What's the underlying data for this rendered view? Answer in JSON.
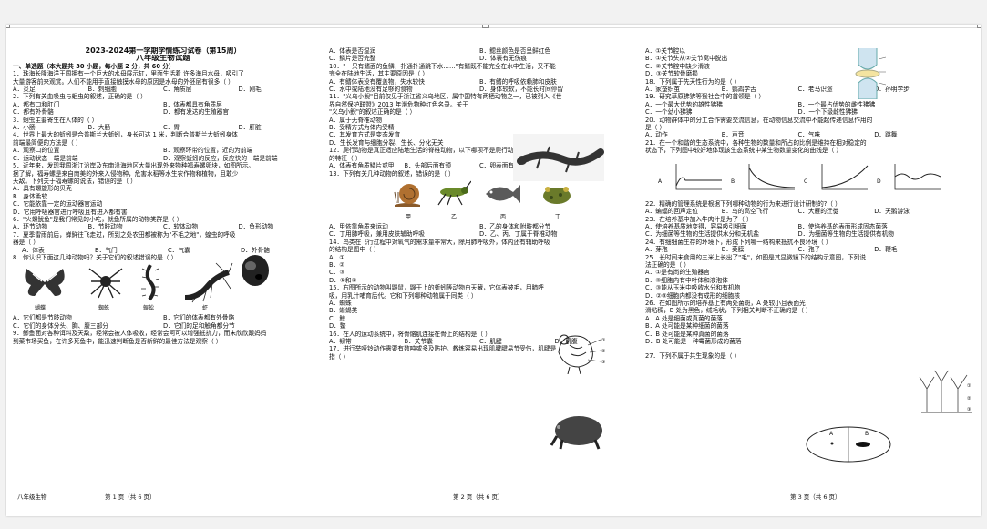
{
  "col1": {
    "title": "2023-2024第一学期学情练习试卷（第15周）",
    "subtitle": "八年级生物试题",
    "sec1": "一、单选题（本大题共 30 小题，每小题 2 分，共 60 分）",
    "l1": "1．珠海长隆海洋王国拥有一个巨大的水母展示缸，里面生活着  许多海月水母，吸引了",
    "l2": "大量游客前来观赏。人们不能用手直接触摸水母的原因是水母的外胚层有很多（     ）",
    "q1": [
      "A．炎足",
      "B．刺细胞",
      "C．角质层",
      "D．刚毛"
    ],
    "l3": "2．下列有关血吸虫与蛔虫的叙述，正确的是（     ）",
    "q2": [
      "A．都有口和肛门",
      "B．体表都具有角质层",
      "C．都有外骨骼",
      "D．都有发达的生殖器官"
    ],
    "l4": "3．蛔虫主要寄生在人体的（     ）",
    "q3": [
      "A．小肠",
      "B．大肠",
      "C．胃",
      "D．肝脏"
    ],
    "l5": "4．世界上最大的蚯蚓是合普斯兰大蚯蚓，身长可达 1 米，判断合普斯兰大蚯蚓身体",
    "l6": "前端最简便的方法是（     ）",
    "q4": [
      "A．观察口的位置",
      "B．观察环带的位置，近的为前端",
      "C．运动状态一端是前端",
      "D．观察蚯蚓的反应，反应快的一端是前端"
    ],
    "l7": "5．近年来，发现我国浙江沿岸及东南沿海地区大量出现外来物种福寿螺卵块，如图所示。",
    "l8": "据了解，福寿螺是来自南美的外来入侵物种，危害水稻等水生农作物和植物，且敢少",
    "l9": "天敌。下列关于福寿螺的说法，错误的是（     ）",
    "q5": [
      "A．具有螺旋形的贝壳",
      "B．身体柔软",
      "C．它能依靠一定的运动器官运动",
      "D．它用呼吸器官进行呼吸且有进入都有害"
    ],
    "l10": "6．\"火螺鱿鱼\"是我们常见的小吃，就鱼所属的动物类群是（     ）",
    "q6": [
      "A．环节动物",
      "B．节肢动物",
      "C．软体动物",
      "D．鱼形动物"
    ],
    "l11": "7．夏季雷雨前后，蝉鲜往飞走过，所到之处农田都被称为\"不毛之地\"，蝗虫的呼吸",
    "l12": "器是（     ）",
    "q7": [
      "A．体表",
      "B．气门",
      "C．气囊",
      "D．外骨骼"
    ],
    "l13": "8．你认识下面这几种动物吗？关于它们的叙述错误的是（     ）",
    "animals": [
      "蝴蝶",
      "蜘蛛",
      "蜈蚣",
      "虾"
    ],
    "q8": [
      "A．它们都是节肢动物",
      "B．它们的体表都有外骨骼",
      "C．它们的身体分头、胸、腹三部分",
      "D．它们的足和触角都分节"
    ],
    "l14": "9．鲫鱼面对各种饵料及天敌，经常会被人体吸收，经常会阿可以增强抵抗力，而末欣欣跟妈妈",
    "l15": "到菜市场买鱼，在许多死鱼中，能迅速判断鱼是否新鲜的最佳方法是观察（     ）"
  },
  "col2": {
    "q9": [
      "A．体表是否湿润",
      "B．鳃丝颜色是否呈鲜红色",
      "C．鳞片是否完整",
      "D．体表有无伤痕"
    ],
    "l1": "10．\"一只有鳍面的鱼鳞，扑通扑通跳下水……\"有鳍既不能完全在水中生活，又不能",
    "l2": "完全在陆地生活，其主要原因是（     ）",
    "q10": [
      "A．有鳍体表没有覆盖物，失水较快",
      "B．有鳍的呼吸依赖肺和皮肤",
      "C．水中或陆地没有足够的食物",
      "D．身体较软，不能长时间停留"
    ],
    "l3": "11．\"义乌小鲵\"目前仅见于浙江省义乌地区，属中国特有两栖动物之一，已被列入《世",
    "l4": "界自然保护联盟》2013 年濒危物种红色名录。关于",
    "l5": "\"义乌小鲵\"的叙述正确的是（     ）",
    "q11": [
      "A．属于无脊椎动物",
      "B．受精方式为体内受精",
      "C．其发育方式是变态发育",
      "D．生长发育与细胞分裂、生长、分化无关"
    ],
    "l6": "12．爬行动物是真正适应陆地生活的脊椎动物，以下哪项不是爬行动物适应陆地生活",
    "l7": "的特征（     ）",
    "q12": [
      "A．体表有角质鳞片或甲",
      "B．头部后面有颈",
      "C．卵表面有坚韧的卵壳",
      "D．用鳃呼吸"
    ],
    "l8": "13．下列有关几种动物的叙述，错误的是（     ）",
    "animals": [
      "甲",
      "乙",
      "丙",
      "丁"
    ],
    "q13": [
      "A．甲依靠角质来运动",
      "B．乙的身体和附肢都分节",
      "C．丁用肺呼吸，兼用皮肤辅助呼吸",
      "D．乙、丙、丁属于脊椎动物"
    ],
    "l9": "14．鸟类在飞行过程中对氧气的需求量非常大，除用肺呼吸外，体内还有辅助呼吸",
    "l10": "的结构是图中（     ）",
    "q14": [
      "A．①",
      "B．②",
      "C．③",
      "D．①和②"
    ],
    "l11": "15．右图所示的动物叫鼹鼠，鼹于上的蚯蚓等动物白天藏，它体表被毛，用肺呼",
    "l12": "吸，用乳汁哺育后代。它和下列哪种动物属于同类（     ）",
    "q15": [
      "A．蜘蛛",
      "B．蜥蜴类",
      "C．鲸",
      "D．鳖"
    ],
    "l13": "16．在人的运动系统中，将骨骼肌连接在骨上的结构是（     ）",
    "q16": [
      "A．韧带",
      "B．关节囊",
      "C．肌腱",
      "D．肌腹"
    ],
    "l14": "17．进行举哑铃动作需要有数吨或多及防护。教练容易出现肌腱腱易节受伤，肌腱是",
    "l15": "指（     ）"
  },
  "col3": {
    "q17": [
      "A．①关节腔以",
      "B．①关节头从②关节窝中脱出",
      "C．②关节腔中缺少滑液",
      "D．③关节软骨磨损"
    ],
    "l1": "18．下列属于先天性行为的是（     ）",
    "q18": [
      "A．家蚕织茧",
      "B．鹦鹉学舌",
      "C．老马识途",
      "D．孙明学步"
    ],
    "l2": "19．研究草原狒狒等猴社会中的首领是（     ）",
    "q19": [
      "A．一个最大优势的雄性狒狒",
      "B．一个最占优势的雌性狒狒",
      "C．一个幼小狒狒",
      "D．一个下级雌性狒狒"
    ],
    "l3": "20．动物群体中的分工合作需要交流信息，在动物信息交流中不能起传递信息作用的",
    "l4": "是（     ）",
    "q20": [
      "A．动作",
      "B．声音",
      "C．气味",
      "D．跳舞"
    ],
    "l5": "21．在一个和谐的生态系统中，各种生物的数量和所占的比例是维持在相对稳定的",
    "l6": "状态下，下列图中较好地体现该生态系统中某生物数量变化的曲线是（     ）",
    "graphs": [
      "A",
      "B",
      "C",
      "D"
    ],
    "l7": "22．精确的管理系统是根据下列哪种动物的行为来进行设计研制的?（     ）",
    "q22": [
      "A．蝙蝠的回声定位",
      "B．鸟的高空飞行",
      "C．大雁的迁徙",
      "D．天鹅游泳"
    ],
    "l8": "23．在培养基中加入牛肉汁是为了（     ）",
    "q23": [
      "A．使培养基质地变得，容易吸引细菌",
      "B．使培养基的表面形成固态菌落",
      "C．为细菌等生物的生活提供水分和无机盐",
      "D．为细菌等生物的生活提供有机物"
    ],
    "l9": "24．有细细菌生存的环境下，形成下列哪一结构来抵抗不良环境（     ）",
    "q24": [
      "A．芽孢",
      "B．荚膜",
      "C．孢子",
      "D．鞭毛"
    ],
    "l10": "25．长时间未食用的三米上长出了\"毛\"，如图是其显微镜下的结构示意图，下列说",
    "l11": "法正确的是（     ）",
    "q25": [
      "A．①是有尚的生殖器官",
      "B．③细胞内有中叶体和液泡体",
      "C．③能从玉米中吸收水分和有机物",
      "D．②③细胞内都没有成形的细胞核"
    ],
    "l12": "26．在如图所示的培养基上有两处菌斑，A 处较小且表面光",
    "l13": "滑粘稠，B 处为黑色，绒毛状，下列相关判断不正确的是（     ）",
    "q26": [
      "A．A 处是细菌或真菌的菌落",
      "B．A 处可能是某种细菌的菌落",
      "C．B 处可能是某种真菌的菌落",
      "D．B 处可能是一种霉菌形成的菌落"
    ],
    "dish": [
      "A",
      "B"
    ],
    "l14": "27．下列不属于共生现象的是（     ）"
  },
  "footer": {
    "subject": "八年级生物",
    "p1": "第 1 页（共 6 页）",
    "p2": "第 2 页（共 6 页）",
    "p3": "第 3 页（共 6 页）"
  }
}
